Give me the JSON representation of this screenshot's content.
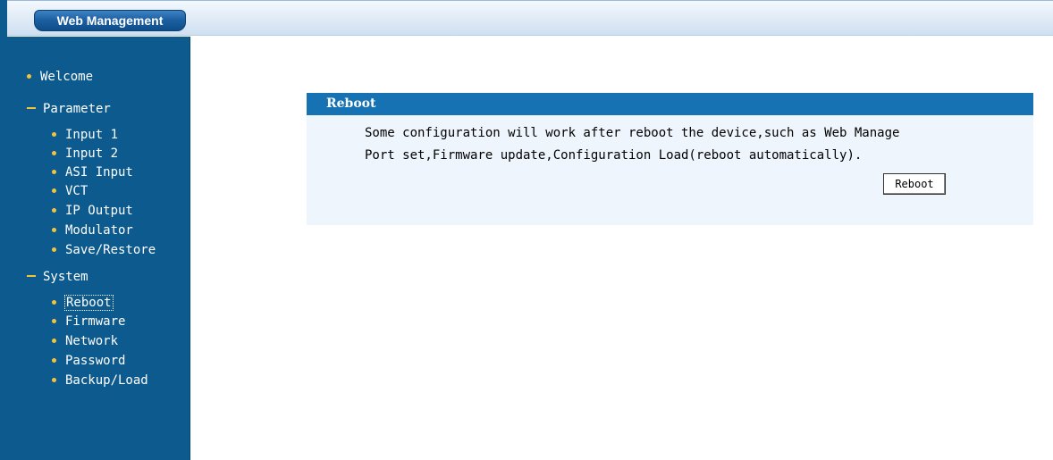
{
  "header": {
    "brand": "Web Management"
  },
  "sidebar": {
    "welcome": "Welcome",
    "parameter": {
      "label": "Parameter",
      "items": [
        "Input 1",
        "Input 2",
        "ASI Input",
        "VCT",
        "IP Output",
        "Modulator",
        "Save/Restore"
      ]
    },
    "system": {
      "label": "System",
      "items": [
        "Reboot",
        "Firmware",
        "Network",
        "Password",
        "Backup/Load"
      ],
      "selected": "Reboot"
    }
  },
  "main": {
    "panel_title": "Reboot",
    "description_line1": "Some configuration will work after reboot the device,such as Web Manage",
    "description_line2": "Port set,Firmware update,Configuration Load(reboot automatically).",
    "reboot_button": "Reboot"
  },
  "colors": {
    "sidebar_bg": "#0c5a8e",
    "bullet": "#f2c43c",
    "panel_header_bg": "#1772b4",
    "panel_bg": "#eef5fc"
  }
}
